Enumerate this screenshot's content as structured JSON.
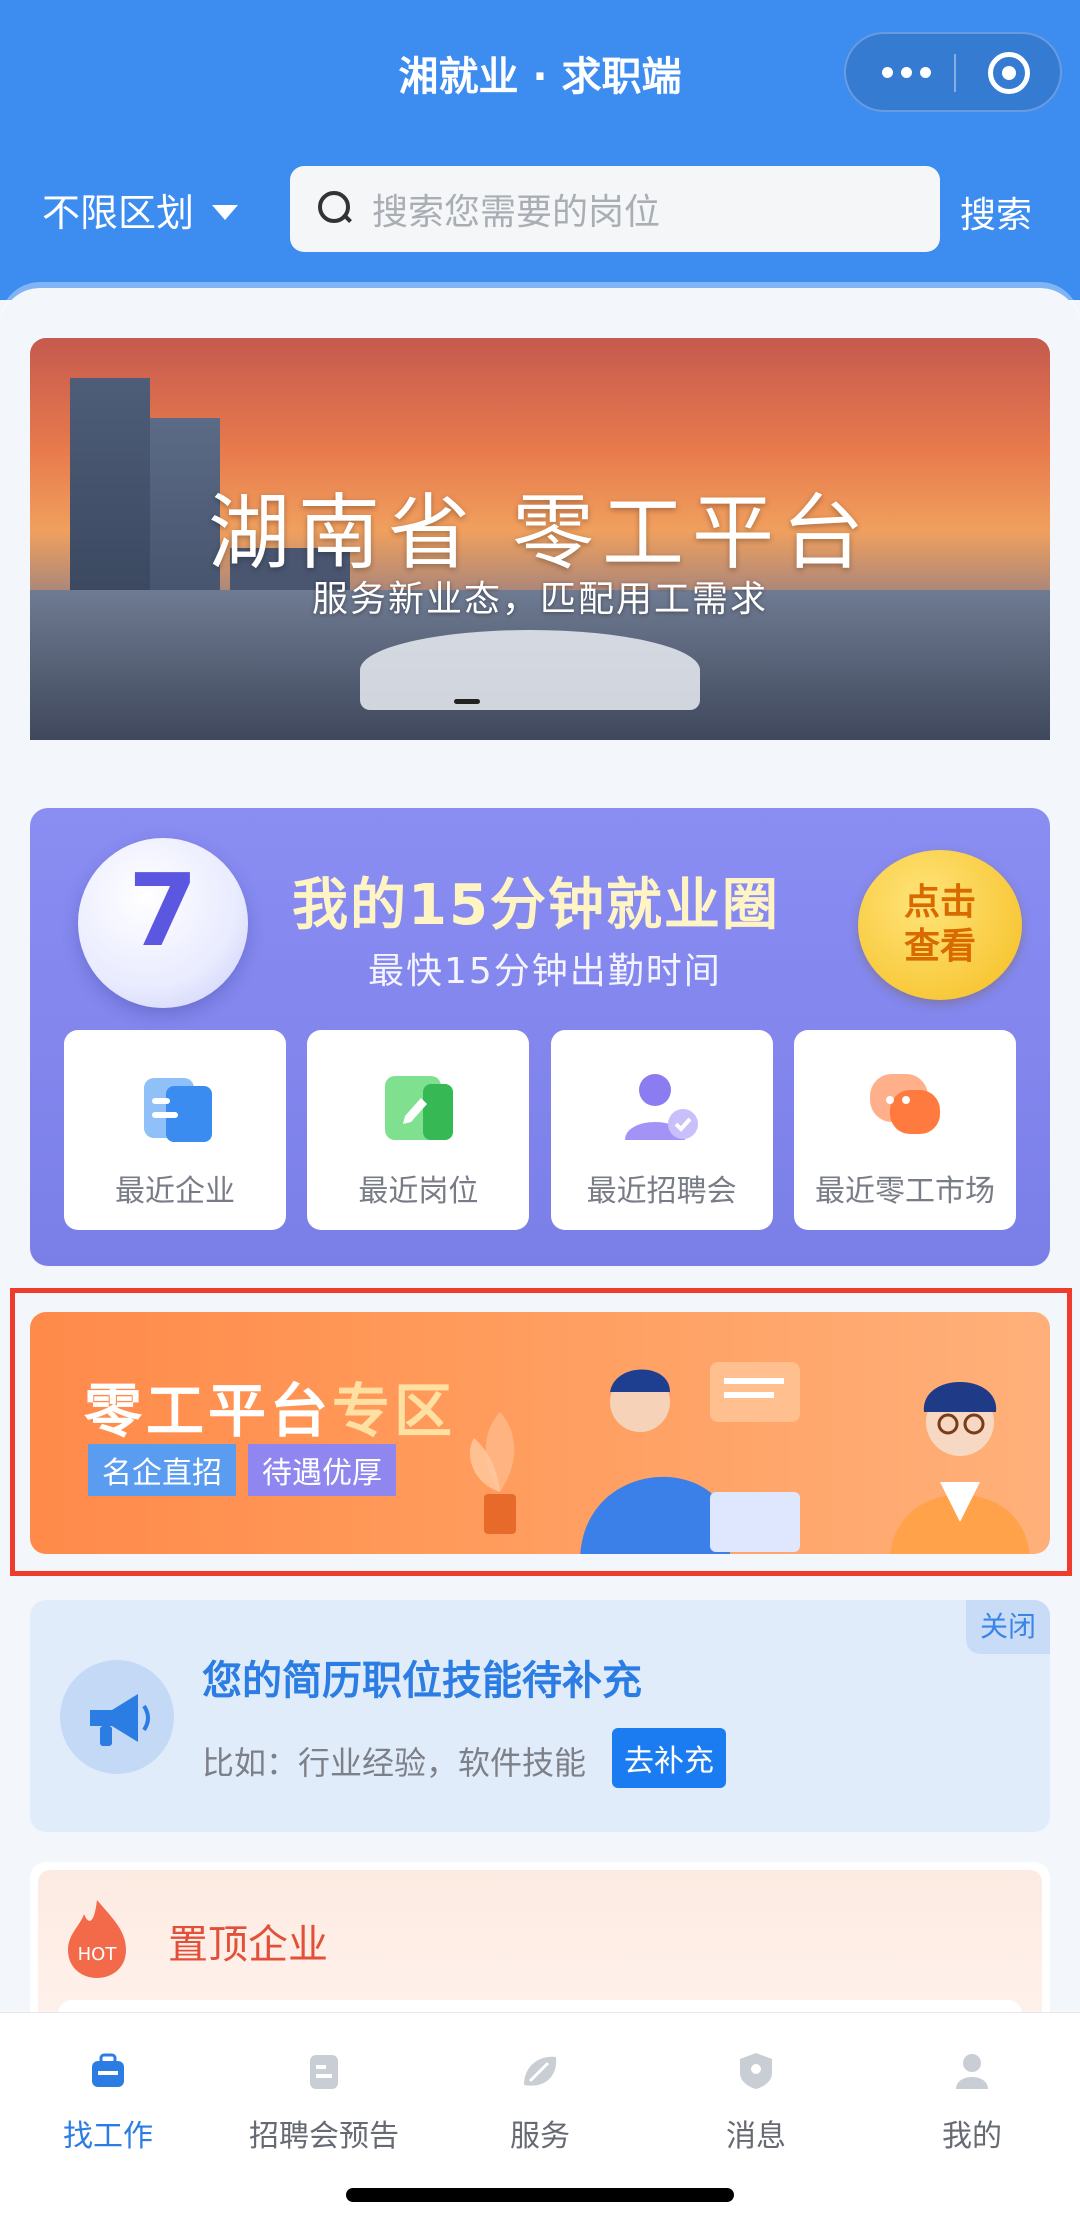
{
  "header": {
    "title": "湘就业 · 求职端",
    "region_label": "不限区划",
    "search_placeholder": "搜索您需要的岗位",
    "search_button": "搜索"
  },
  "banner": {
    "title": "湖南省 零工平台",
    "subtitle": "服务新业态，匹配用工需求"
  },
  "employment_circle": {
    "title": "我的15分钟就业圈",
    "subtitle": "最快15分钟出勤时间",
    "clock_number": "7",
    "view_button": "点击查看",
    "shortcuts": [
      {
        "label": "最近企业",
        "icon": "company-icon",
        "color": "#5b9cf0"
      },
      {
        "label": "最近岗位",
        "icon": "job-edit-icon",
        "color": "#4fcf6e"
      },
      {
        "label": "最近招聘会",
        "icon": "job-fair-person-icon",
        "color": "#8a7cf0"
      },
      {
        "label": "最近零工市场",
        "icon": "chat-bubble-icon",
        "color": "#ff8a52"
      }
    ]
  },
  "promo": {
    "title_main": "零工平台",
    "title_highlight": "专区",
    "tags": [
      "名企直招",
      "待遇优厚"
    ]
  },
  "resume_notice": {
    "close_label": "关闭",
    "title": "您的简历职位技能待补充",
    "description": "比如：行业经验，软件技能",
    "action_button": "去补充"
  },
  "top_companies": {
    "badge": "HOT",
    "title": "置顶企业"
  },
  "tabbar": {
    "items": [
      {
        "label": "找工作",
        "icon": "briefcase-icon",
        "active": true
      },
      {
        "label": "招聘会预告",
        "icon": "document-icon",
        "active": false
      },
      {
        "label": "服务",
        "icon": "service-leaf-icon",
        "active": false
      },
      {
        "label": "消息",
        "icon": "shield-message-icon",
        "active": false
      },
      {
        "label": "我的",
        "icon": "user-icon",
        "active": false
      }
    ]
  },
  "colors": {
    "primary": "#3d8cf0",
    "accent_orange": "#ff8a4a",
    "active_tab": "#2b7de3"
  }
}
